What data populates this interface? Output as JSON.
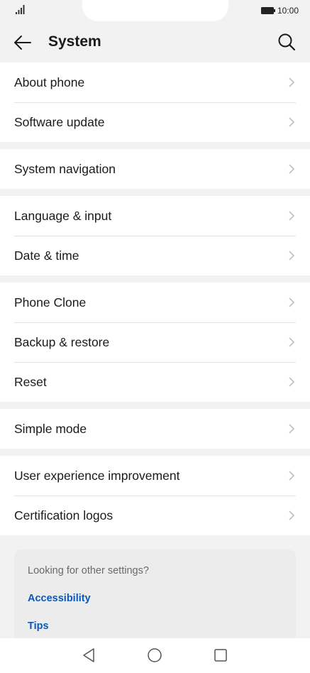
{
  "status_bar": {
    "time": "10:00",
    "signal_icon": "signal-icon",
    "battery_icon": "battery-icon"
  },
  "header": {
    "title": "System",
    "back_icon": "arrow-left-icon",
    "search_icon": "search-icon"
  },
  "groups": [
    {
      "items": [
        "About phone",
        "Software update"
      ]
    },
    {
      "items": [
        "System navigation"
      ]
    },
    {
      "items": [
        "Language & input",
        "Date & time"
      ]
    },
    {
      "items": [
        "Phone Clone",
        "Backup & restore",
        "Reset"
      ]
    },
    {
      "items": [
        "Simple mode"
      ]
    },
    {
      "items": [
        "User experience improvement",
        "Certification logos"
      ]
    }
  ],
  "suggestions": {
    "title": "Looking for other settings?",
    "links": [
      "Accessibility",
      "Tips"
    ],
    "link_color": "#0a59bf"
  },
  "nav": {
    "back_icon": "triangle-back-icon",
    "home_icon": "circle-home-icon",
    "recents_icon": "square-recents-icon"
  }
}
